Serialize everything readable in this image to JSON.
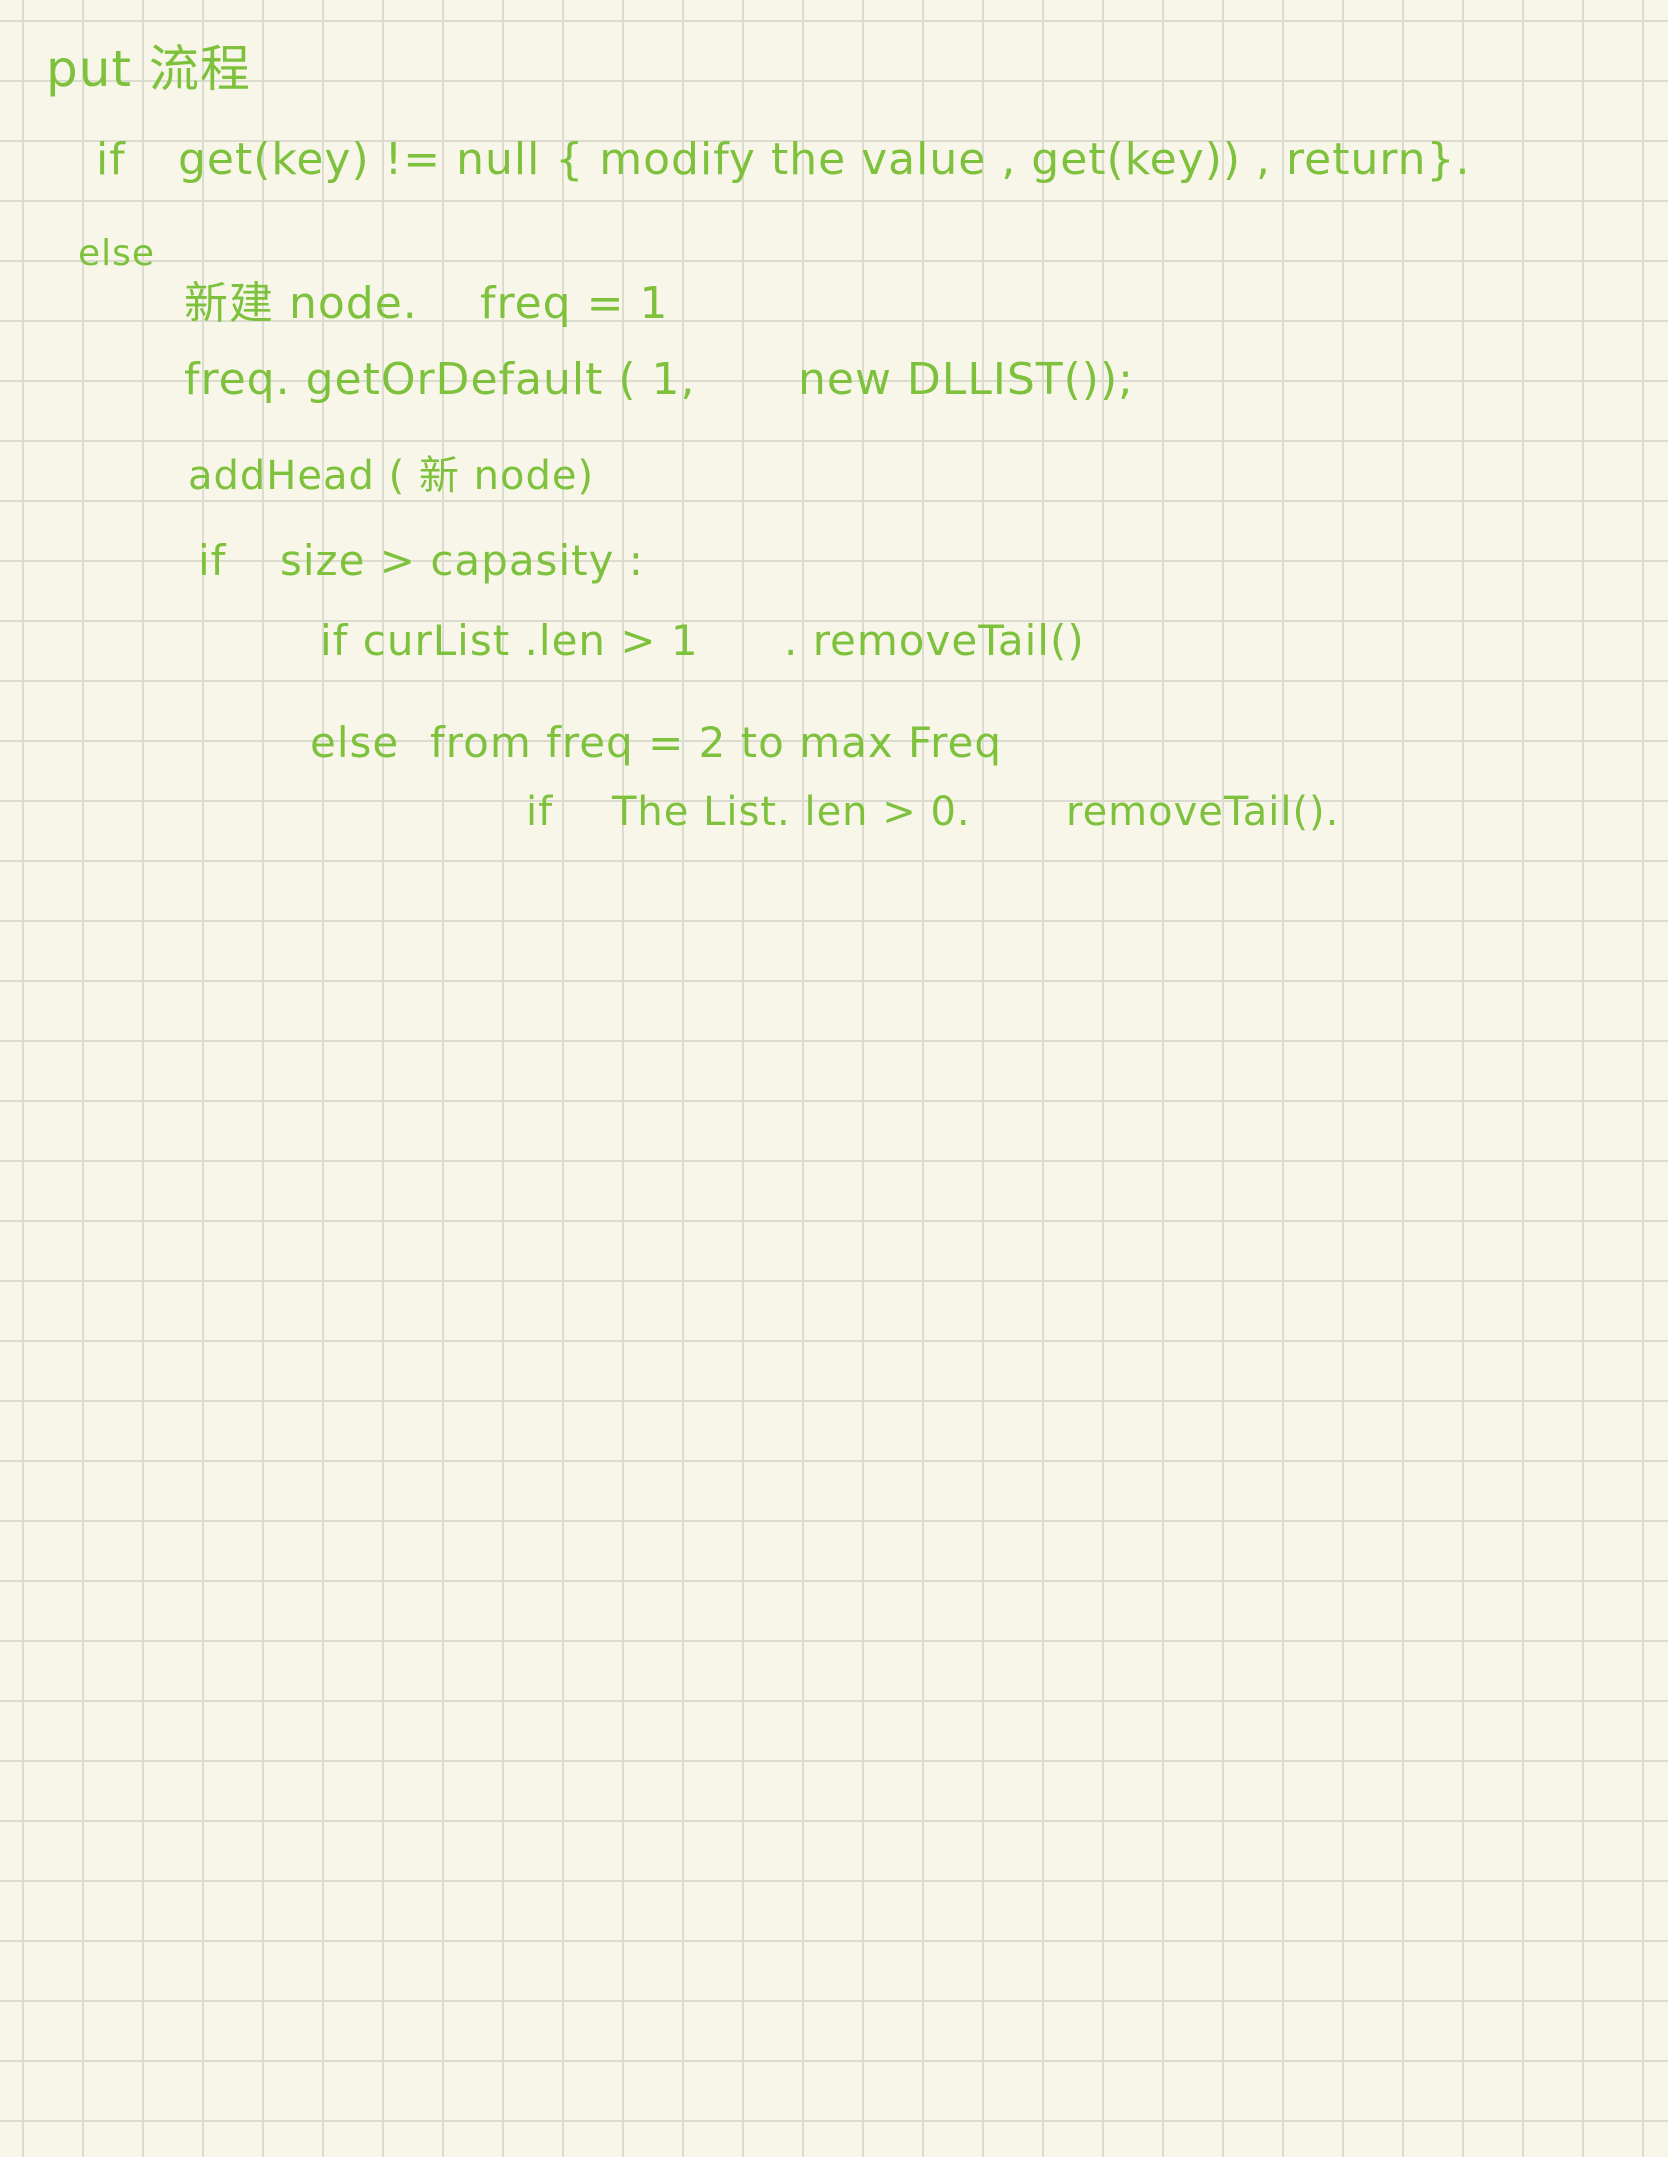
{
  "note": {
    "title": "put 流程",
    "lines": [
      {
        "id": "if-get",
        "segments": [
          "if",
          "get(key) != null { modify the value , get(key)) , return}."
        ]
      },
      {
        "id": "else",
        "segments": [
          "else"
        ]
      },
      {
        "id": "new-node",
        "segments": [
          "新建 node.",
          "freq = 1"
        ]
      },
      {
        "id": "get-or-default",
        "segments": [
          "freq. getOrDefault ( 1,",
          "new DLLIST());"
        ]
      },
      {
        "id": "add-head",
        "segments": [
          "addHead ( 新 node)"
        ]
      },
      {
        "id": "if-size",
        "segments": [
          "if",
          "size > capasity :"
        ]
      },
      {
        "id": "if-curlist",
        "segments": [
          "if curList .len > 1",
          ". removeTail()"
        ]
      },
      {
        "id": "else-from",
        "segments": [
          "else",
          "from freq = 2 to max Freq"
        ]
      },
      {
        "id": "if-thelist",
        "segments": [
          "if",
          "The List. len > 0.",
          "removeTail()."
        ]
      }
    ]
  }
}
